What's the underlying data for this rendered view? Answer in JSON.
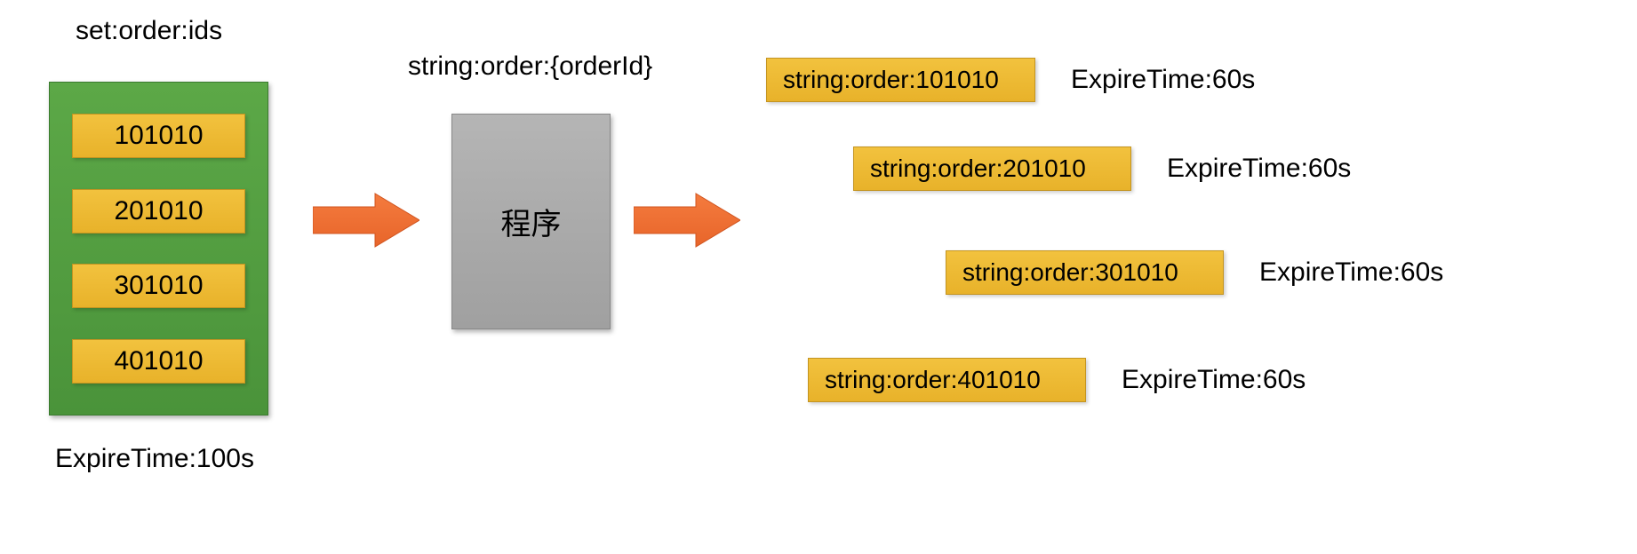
{
  "set": {
    "label": "set:order:ids",
    "items": [
      "101010",
      "201010",
      "301010",
      "401010"
    ],
    "expire": "ExpireTime:100s"
  },
  "pattern": "string:order:{orderId}",
  "program": "程序",
  "outputs": [
    {
      "key": "string:order:101010",
      "expire": "ExpireTime:60s"
    },
    {
      "key": "string:order:201010",
      "expire": "ExpireTime:60s"
    },
    {
      "key": "string:order:301010",
      "expire": "ExpireTime:60s"
    },
    {
      "key": "string:order:401010",
      "expire": "ExpireTime:60s"
    }
  ]
}
